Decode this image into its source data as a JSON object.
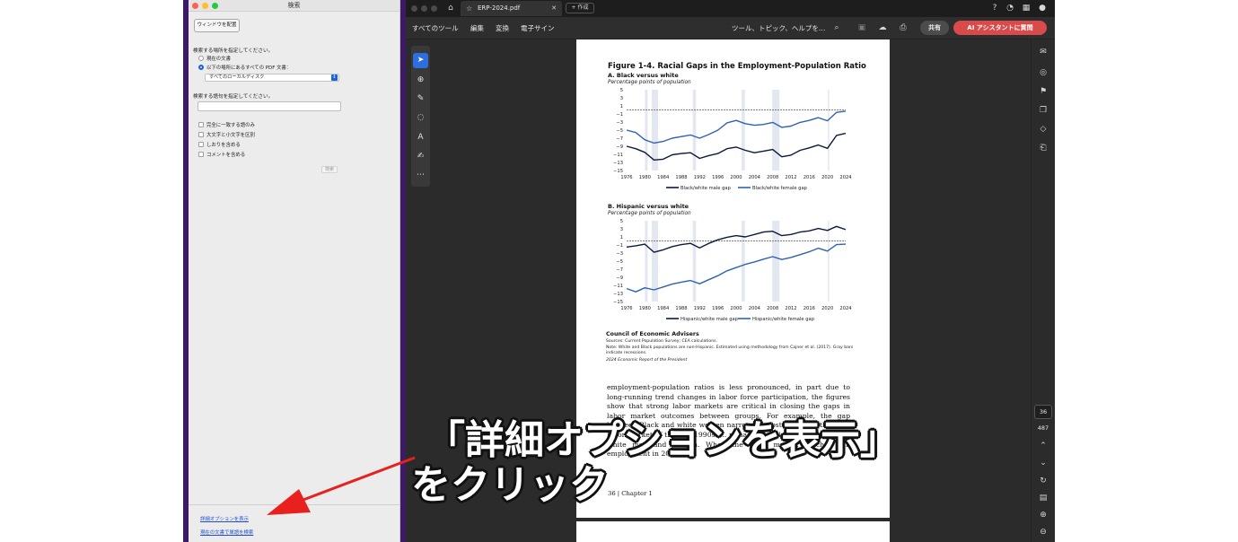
{
  "search_panel": {
    "window_title": "検索",
    "arrange_button": "ウィンドウを配置",
    "where_label": "検索する場所を指定してください。",
    "option_current": "現在の文書",
    "option_all_pdfs": "以下の場所にあるすべての PDF 文書：",
    "location_value": "すべてのローカルディスク",
    "words_label": "検索する語句を指定してください。",
    "search_input_value": "",
    "checkbox_whole_words": "完全に一致する語のみ",
    "checkbox_case": "大文字と小文字を区別",
    "checkbox_bookmarks": "しおりを含める",
    "checkbox_comments": "コメントを含める",
    "search_button": "検索",
    "link_advanced": "詳細オプションを表示",
    "link_find_in_doc": "現在の文書で単語を検索",
    "selected_option": "option_all_pdfs"
  },
  "acrobat": {
    "tab_title": "ERP-2024.pdf",
    "new_tab": "作成",
    "menu": [
      "すべてのツール",
      "編集",
      "変換",
      "電子サイン"
    ],
    "search_placeholder": "ツール、トピック、ヘルプを…",
    "share_button": "共有",
    "ai_button": "AI アシスタントに質問",
    "current_page": "36",
    "total_pages": "487",
    "accent_color": "#2e6fe0",
    "ai_color": "#d94a4a"
  },
  "document": {
    "figure_title": "Figure 1-4. Racial Gaps in the Employment-Population Ratio",
    "panel_a_title": "A. Black versus white",
    "panel_b_title": "B. Hispanic versus white",
    "unit_label": "Percentage points of population",
    "source_org": "Council of Economic Advisers",
    "sources": "Sources: Current Population Survey; CEA calculations.",
    "note": "Note: White and Black populations are non-Hispanic. Estimated using methodology from Cajner et al. (2017). Gray bars indicate recessions.",
    "report": "2024 Economic Report of the President",
    "body": "employment-population ratios is less pronounced, in part due to long-running trend changes in labor force participation, the figures show that strong labor markets are critical in closing the gaps in labor market outcomes between groups. For example, the gap between Black and white women narrowed substantially in the tight labor market of the late 1990s. ... remained weak ... was a lack of ... white men and women. When the labor market reached full employment in 2015–19,",
    "folio": "36 |   Chapter 1"
  },
  "chart_data": [
    {
      "type": "line",
      "title": "A. Black versus white",
      "ylabel": "Percentage points of population",
      "xlim": [
        1976,
        2024
      ],
      "ylim": [
        -15,
        5
      ],
      "x_ticks": [
        1976,
        1980,
        1984,
        1988,
        1992,
        1996,
        2000,
        2004,
        2008,
        2012,
        2016,
        2020,
        2024
      ],
      "y_ticks": [
        5,
        3,
        1,
        -1,
        -3,
        -5,
        -7,
        -9,
        -11,
        -13,
        -15
      ],
      "grid": false,
      "legend": "bottom",
      "recessions": [
        [
          1980,
          1980.6
        ],
        [
          1981.5,
          1982.9
        ],
        [
          1990.5,
          1991.2
        ],
        [
          2001.2,
          2001.9
        ],
        [
          2007.9,
          2009.5
        ],
        [
          2020.1,
          2020.4
        ]
      ],
      "x": [
        1976,
        1978,
        1980,
        1982,
        1984,
        1986,
        1988,
        1990,
        1992,
        1994,
        1996,
        1998,
        2000,
        2002,
        2004,
        2006,
        2008,
        2010,
        2012,
        2014,
        2016,
        2018,
        2020,
        2022,
        2024
      ],
      "series": [
        {
          "name": "Black/white male gap",
          "color": "#0b1a3c",
          "values": [
            -9,
            -9.6,
            -10.5,
            -12.4,
            -12.2,
            -11.1,
            -10.8,
            -10.6,
            -12,
            -11.3,
            -10.8,
            -9.6,
            -9.2,
            -10,
            -10.6,
            -10.2,
            -9.8,
            -11.6,
            -11.2,
            -10,
            -9.4,
            -8.7,
            -9.5,
            -6.3,
            -5.8
          ]
        },
        {
          "name": "Black/white female gap",
          "color": "#2f62b1",
          "values": [
            -5,
            -5.6,
            -7.4,
            -8.2,
            -7.8,
            -7,
            -6.6,
            -6.2,
            -7,
            -6.1,
            -5,
            -3.2,
            -2.6,
            -3.4,
            -3.8,
            -3.6,
            -3.1,
            -4.3,
            -4,
            -3.1,
            -2.6,
            -1.9,
            -2.7,
            -0.6,
            -0.3
          ]
        }
      ]
    },
    {
      "type": "line",
      "title": "B. Hispanic versus white",
      "ylabel": "Percentage points of population",
      "xlim": [
        1976,
        2024
      ],
      "ylim": [
        -15,
        5
      ],
      "x_ticks": [
        1976,
        1980,
        1984,
        1988,
        1992,
        1996,
        2000,
        2004,
        2008,
        2012,
        2016,
        2020,
        2024
      ],
      "y_ticks": [
        5,
        3,
        1,
        -1,
        -3,
        -5,
        -7,
        -9,
        -11,
        -13,
        -15
      ],
      "grid": false,
      "legend": "bottom",
      "recessions": [
        [
          1980,
          1980.6
        ],
        [
          1981.5,
          1982.9
        ],
        [
          1990.5,
          1991.2
        ],
        [
          2001.2,
          2001.9
        ],
        [
          2007.9,
          2009.5
        ],
        [
          2020.1,
          2020.4
        ]
      ],
      "x": [
        1976,
        1978,
        1980,
        1982,
        1984,
        1986,
        1988,
        1990,
        1992,
        1994,
        1996,
        1998,
        2000,
        2002,
        2004,
        2006,
        2008,
        2010,
        2012,
        2014,
        2016,
        2018,
        2020,
        2022,
        2024
      ],
      "series": [
        {
          "name": "Hispanic/white male gap",
          "color": "#0b1a3c",
          "values": [
            -1.5,
            -1.2,
            -0.8,
            -2.8,
            -2.2,
            -1.4,
            -0.9,
            -0.6,
            -1.7,
            -0.6,
            0.3,
            0.9,
            1.3,
            1,
            1.6,
            2.2,
            2.4,
            1.3,
            1.6,
            2.2,
            2.5,
            3.1,
            2.6,
            3.6,
            2.8
          ]
        },
        {
          "name": "Hispanic/white female gap",
          "color": "#2f62b1",
          "values": [
            -11.8,
            -12.6,
            -11.6,
            -12.1,
            -11.4,
            -10.7,
            -10.2,
            -9.8,
            -10.6,
            -9.6,
            -8.6,
            -7.4,
            -6.6,
            -5.8,
            -5.2,
            -4.5,
            -3.9,
            -4.6,
            -4.1,
            -3.4,
            -2.7,
            -1.8,
            -2.5,
            -0.9,
            -0.8
          ]
        }
      ]
    }
  ],
  "annotation": {
    "line1": "「詳細オプションを表示」",
    "line2": "をクリック",
    "arrow_color": "#e8211f"
  }
}
